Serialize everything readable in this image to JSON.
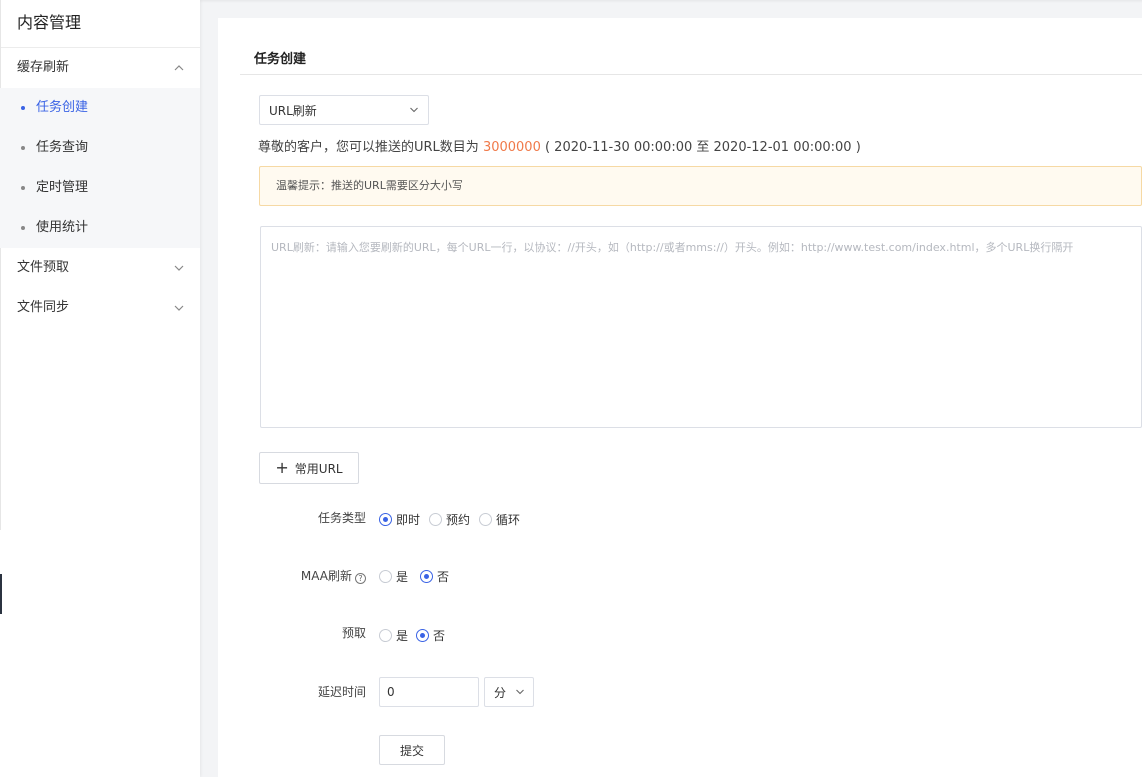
{
  "sidebar": {
    "title": "内容管理",
    "groups": [
      {
        "label": "缓存刷新",
        "expanded": true,
        "items": [
          {
            "label": "任务创建",
            "active": true
          },
          {
            "label": "任务查询"
          },
          {
            "label": "定时管理"
          },
          {
            "label": "使用统计"
          }
        ]
      },
      {
        "label": "文件预取",
        "expanded": false
      },
      {
        "label": "文件同步",
        "expanded": false
      }
    ]
  },
  "panel": {
    "title": "任务创建",
    "refresh_type_select": "URL刷新",
    "notice": {
      "prefix": "尊敬的客户，您可以推送的URL数目为 ",
      "count": "3000000",
      "suffix": " ( 2020-11-30 00:00:00 至 2020-12-01 00:00:00 )"
    },
    "tip": "温馨提示：推送的URL需要区分大小写",
    "url_input_placeholder": "URL刷新：请输入您要刷新的URL，每个URL一行，以协议：//开头，如（http://或者mms://）开头。例如：http://www.test.com/index.html，多个URL换行隔开",
    "common_url_button": "常用URL",
    "task_type": {
      "label": "任务类型",
      "options": [
        "即时",
        "预约",
        "循环"
      ],
      "selected": "即时"
    },
    "maa_refresh": {
      "label": "MAA刷新",
      "options": [
        "是",
        "否"
      ],
      "selected": "否"
    },
    "prefetch": {
      "label": "预取",
      "options": [
        "是",
        "否"
      ],
      "selected": "否"
    },
    "delay": {
      "label": "延迟时间",
      "value": "0",
      "unit": "分"
    },
    "submit_button": "提交"
  },
  "colors": {
    "accent": "#3a63e5",
    "highlight_count": "#f07a4a",
    "tip_background": "#fffaf0",
    "tip_border": "#f6d9a4"
  }
}
